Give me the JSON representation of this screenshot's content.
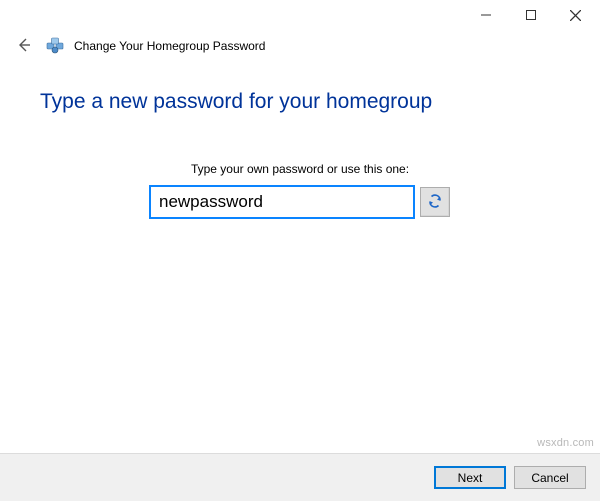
{
  "titlebar": {
    "minimize_icon": "minimize-icon",
    "maximize_icon": "maximize-icon",
    "close_icon": "close-icon"
  },
  "header": {
    "wizard_title": "Change Your Homegroup Password"
  },
  "body": {
    "headline": "Type a new password for your homegroup",
    "prompt": "Type your own password or use this one:",
    "password_value": "newpassword",
    "refresh_tooltip": "Generate new password"
  },
  "footer": {
    "next_label": "Next",
    "cancel_label": "Cancel"
  },
  "watermark": "wsxdn.com"
}
